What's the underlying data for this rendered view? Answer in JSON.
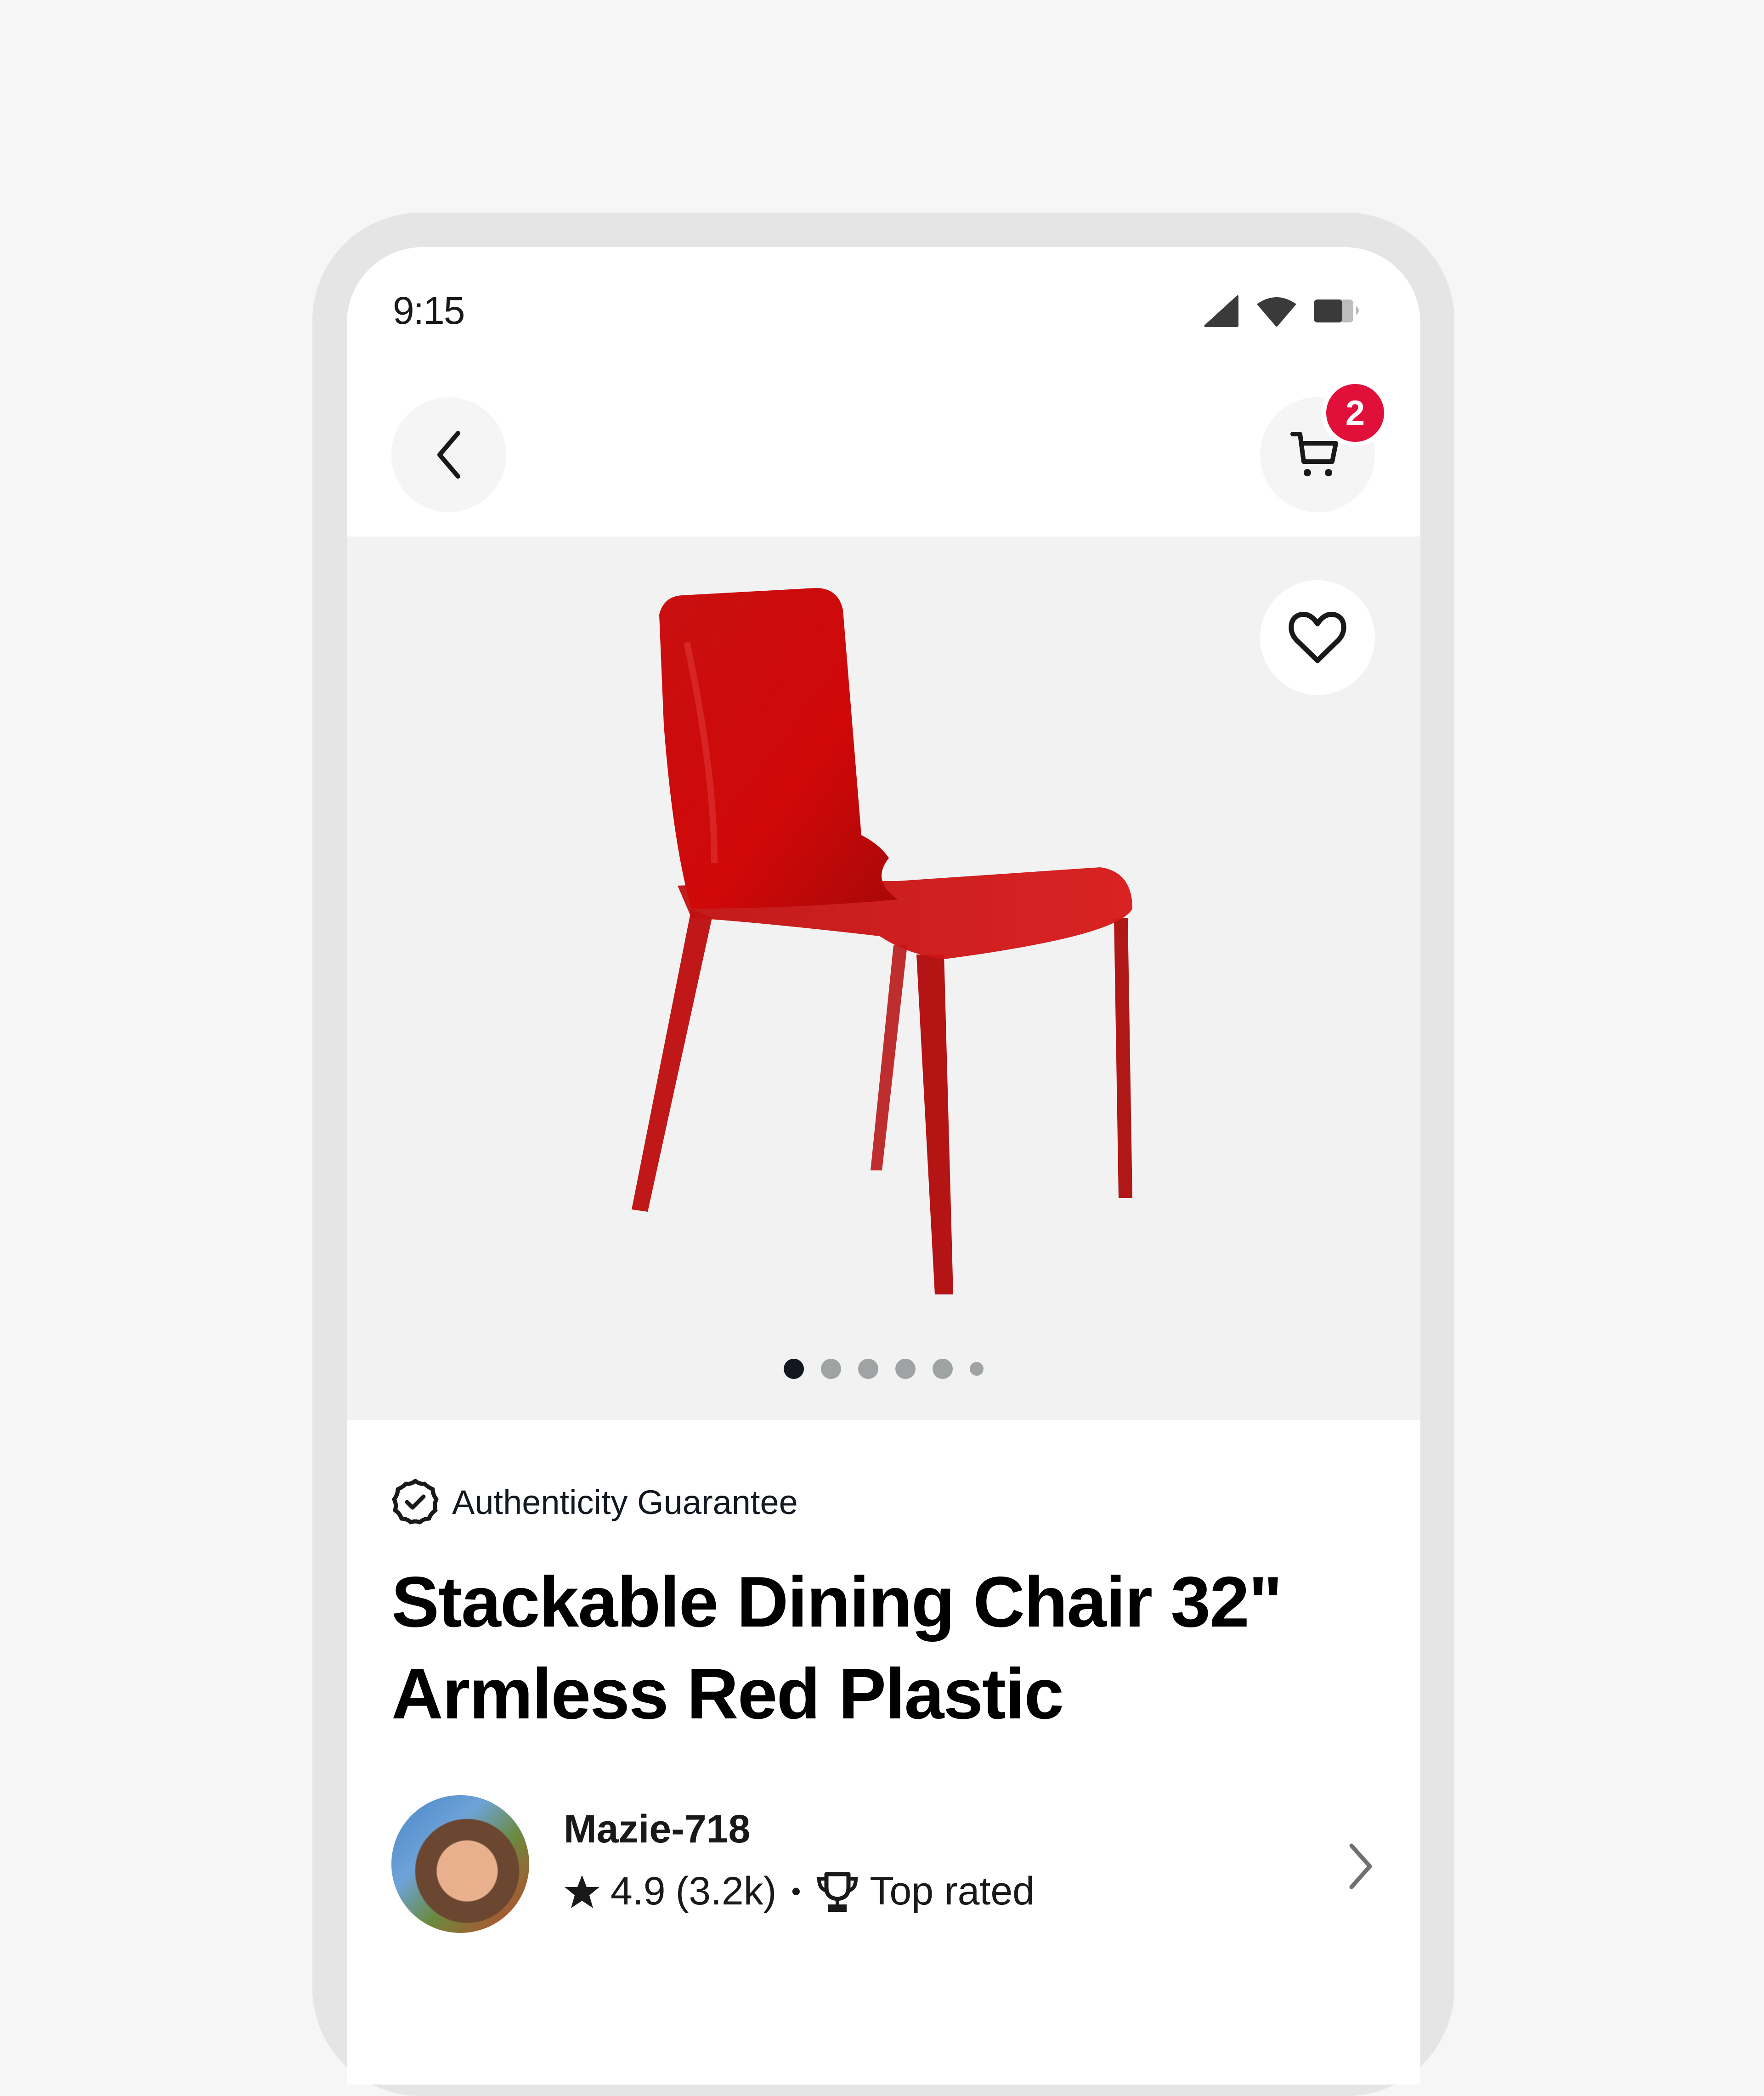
{
  "status_bar": {
    "time": "9:15",
    "icons": [
      "cellular-signal-icon",
      "wifi-icon",
      "battery-icon"
    ]
  },
  "nav": {
    "back_icon": "chevron-left-icon",
    "cart_icon": "shopping-cart-icon",
    "cart_count": "2",
    "badge_color": "#e0103a"
  },
  "gallery": {
    "image_alt": "Red transparent stackable dining chair",
    "favorite_icon": "heart-icon",
    "page_count": 6,
    "current_page": 1
  },
  "product": {
    "authenticity_label": "Authenticity Guarantee",
    "title": "Stackable Dining Chair 32\" Armless Red Plastic"
  },
  "seller": {
    "name": "Mazie-718",
    "rating": "4.9",
    "review_count": "(3.2k)",
    "separator": "•",
    "badge_label": "Top rated"
  }
}
